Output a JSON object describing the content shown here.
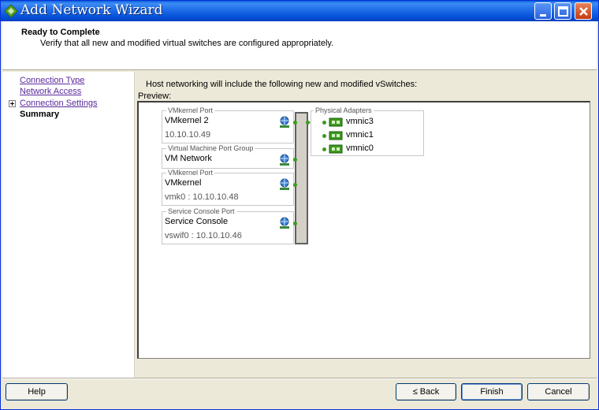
{
  "window": {
    "title": "Add Network Wizard",
    "controls": [
      "minimize",
      "maximize",
      "close"
    ]
  },
  "header": {
    "title": "Ready to Complete",
    "subtitle": "Verify that all new and modified virtual switches are configured appropriately."
  },
  "nav": {
    "items": [
      {
        "label": "Connection Type",
        "state": "link"
      },
      {
        "label": "Network Access",
        "state": "link"
      },
      {
        "label": "Connection Settings",
        "state": "link",
        "expandable": true
      },
      {
        "label": "Summary",
        "state": "current"
      }
    ]
  },
  "main": {
    "intro": "Host networking will include the following new and modified vSwitches:",
    "preview_label": "Preview:",
    "ports": [
      {
        "group": "VMkernel Port",
        "name": "VMkernel 2",
        "detail": "10.10.10.49",
        "icon": "network-globe-icon"
      },
      {
        "group": "Virtual Machine Port Group",
        "name": "VM Network",
        "detail": "",
        "icon": "network-globe-icon"
      },
      {
        "group": "VMkernel Port",
        "name": "VMkernel",
        "detail": "vmk0 : 10.10.10.48",
        "icon": "network-globe-icon"
      },
      {
        "group": "Service Console Port",
        "name": "Service Console",
        "detail": "vswif0 : 10.10.10.46",
        "icon": "network-globe-icon"
      }
    ],
    "adapters": {
      "label": "Physical Adapters",
      "nics": [
        "vmnic3",
        "vmnic1",
        "vmnic0"
      ]
    }
  },
  "footer": {
    "help": "Help",
    "back": "≤ Back",
    "finish": "Finish",
    "cancel": "Cancel"
  },
  "colors": {
    "titlebar": "#0a5fdd",
    "window_bg": "#ece9d8",
    "link": "#5a2a9c",
    "connector": "#3c9a1e"
  }
}
